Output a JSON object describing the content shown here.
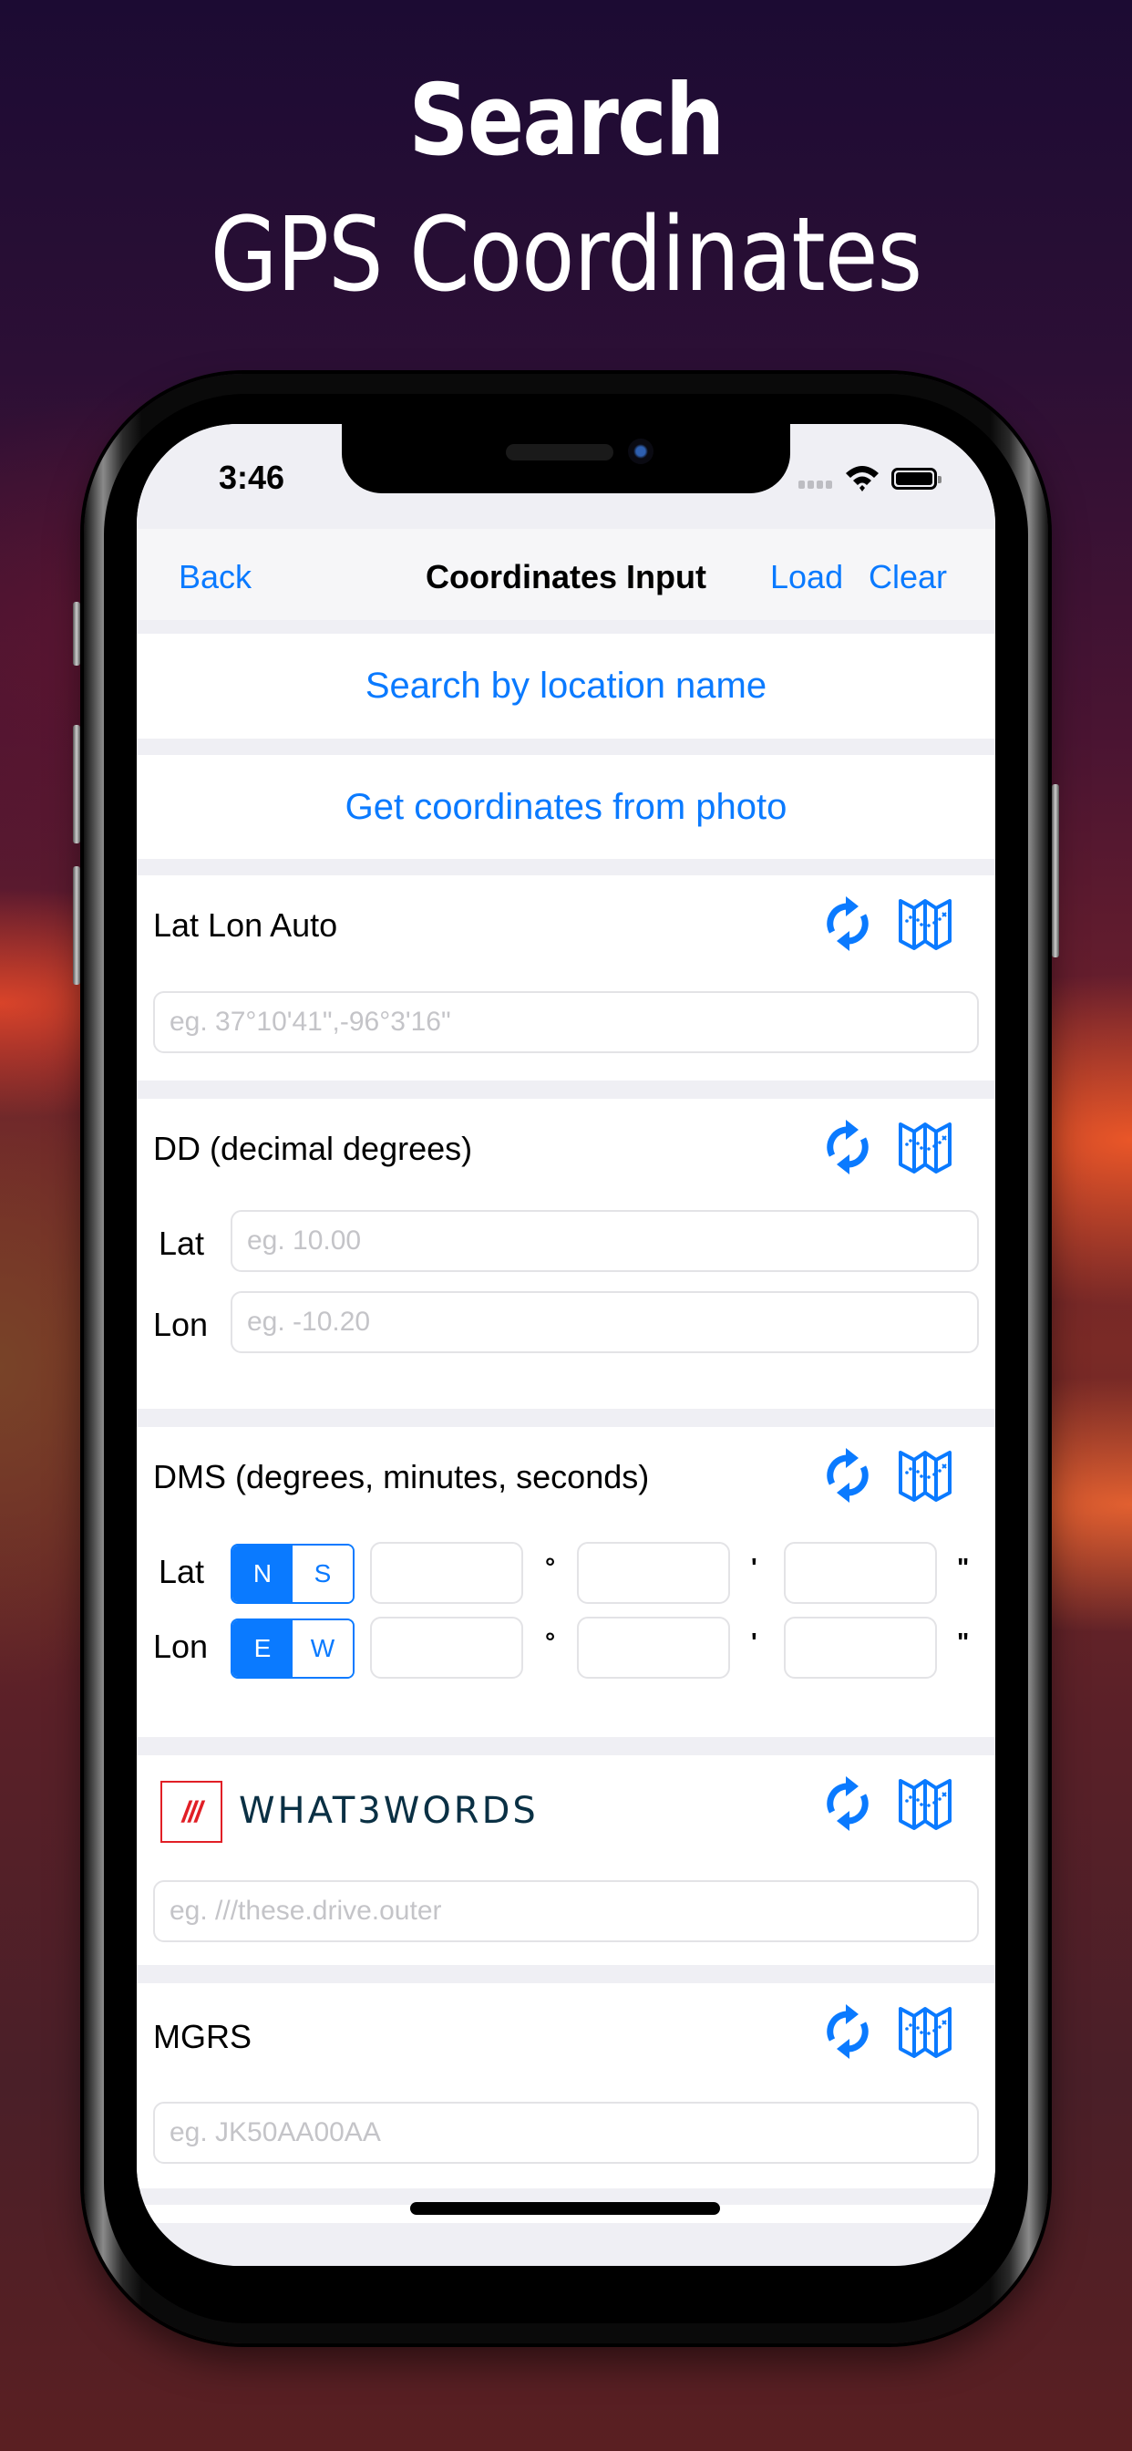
{
  "hero": {
    "line1": "Search",
    "line2": "GPS Coordinates"
  },
  "status_bar": {
    "time": "3:46",
    "icons": [
      "signal-icon",
      "wifi-icon",
      "battery-icon"
    ]
  },
  "navbar": {
    "back_label": "Back",
    "title": "Coordinates Input",
    "load_label": "Load",
    "clear_label": "Clear"
  },
  "actions": {
    "search_by_location": "Search by location name",
    "from_photo": "Get coordinates from photo"
  },
  "sections": {
    "latlon_auto": {
      "title": "Lat Lon Auto",
      "placeholder": "eg. 37°10'41\",-96°3'16\"",
      "value": ""
    },
    "dd": {
      "title": "DD (decimal degrees)",
      "lat_label": "Lat",
      "lat_placeholder": "eg. 10.00",
      "lon_label": "Lon",
      "lon_placeholder": "eg. -10.20"
    },
    "dms": {
      "title": "DMS (degrees, minutes, seconds)",
      "lat_label": "Lat",
      "lon_label": "Lon",
      "lat_hemispheres": [
        "N",
        "S"
      ],
      "lat_selected": "N",
      "lon_hemispheres": [
        "E",
        "W"
      ],
      "lon_selected": "E",
      "degree_symbol": "°",
      "minute_symbol": "'",
      "second_symbol": "\""
    },
    "w3w": {
      "logo_mark": "///",
      "logo_text": "WHAT3WORDS",
      "placeholder": "eg. ///these.drive.outer"
    },
    "mgrs": {
      "title": "MGRS",
      "placeholder": "eg. JK50AA00AA"
    }
  },
  "colors": {
    "accent": "#0a7aff",
    "w3w_red": "#e11f26",
    "w3w_navy": "#0a3044",
    "grouped_background": "#efeff4"
  }
}
